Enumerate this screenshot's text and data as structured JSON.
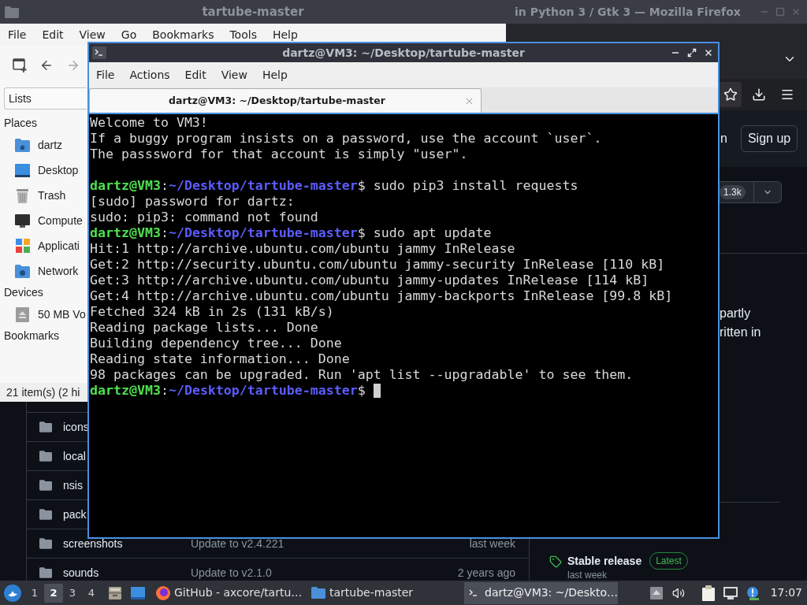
{
  "file_manager": {
    "title": "tartube-master",
    "menu": [
      "File",
      "Edit",
      "View",
      "Go",
      "Bookmarks",
      "Tools",
      "Help"
    ],
    "side_pane": "Lists",
    "sections": [
      {
        "heading": "Places",
        "items": [
          {
            "label": "dartz",
            "kind": "home"
          },
          {
            "label": "Desktop",
            "kind": "desktop"
          },
          {
            "label": "Trash",
            "kind": "trash"
          },
          {
            "label": "Compute",
            "kind": "computer"
          },
          {
            "label": "Applicati",
            "kind": "applications"
          },
          {
            "label": "Network",
            "kind": "network"
          }
        ]
      },
      {
        "heading": "Devices",
        "items": [
          {
            "label": "50 MB Vo",
            "kind": "drive"
          }
        ]
      },
      {
        "heading": "Bookmarks"
      }
    ],
    "status": "21 item(s) (2 hi"
  },
  "browser": {
    "title": "in Python 3 / Gtk 3 — Mozilla Firefox",
    "header_link": "n",
    "signup_button": "Sign up",
    "button_counter": "1.3k",
    "about_text": [
      "partly",
      "ritten in"
    ],
    "files": [
      {
        "name": "icons"
      },
      {
        "name": "local"
      },
      {
        "name": "nsis"
      },
      {
        "name": "pack"
      },
      {
        "name": "screenshots",
        "message": "Update to v2.4.221",
        "date": "last week"
      },
      {
        "name": "sounds",
        "message": "Update to v2.1.0",
        "date": "2 years ago"
      }
    ],
    "release": {
      "title": "Stable release",
      "label": "Latest",
      "date": "last week"
    }
  },
  "terminal": {
    "title": "dartz@VM3: ~/Desktop/tartube-master",
    "menu": [
      "File",
      "Actions",
      "Edit",
      "View",
      "Help"
    ],
    "tabs": [
      {
        "label": "dartz@VM3: ~/Desktop/tartube-master",
        "selected": true
      }
    ],
    "lines": [
      {
        "kind": "output",
        "text": "Welcome to VM3!"
      },
      {
        "kind": "output",
        "text": "If a buggy program insists on a password, use the account `user`."
      },
      {
        "kind": "output",
        "text": "The passsword for that account is simply \"user\"."
      },
      {
        "kind": "blank"
      },
      {
        "kind": "prompt",
        "user": "dartz@VM3",
        "separator": ":",
        "path": "~/Desktop/tartube-master",
        "command": "$ sudo pip3 install requests"
      },
      {
        "kind": "output",
        "text": "[sudo] password for dartz:"
      },
      {
        "kind": "output",
        "text": "sudo: pip3: command not found"
      },
      {
        "kind": "prompt",
        "user": "dartz@VM3",
        "separator": ":",
        "path": "~/Desktop/tartube-master",
        "command": "$ sudo apt update"
      },
      {
        "kind": "output",
        "text": "Hit:1 http://archive.ubuntu.com/ubuntu jammy InRelease"
      },
      {
        "kind": "output",
        "text": "Get:2 http://security.ubuntu.com/ubuntu jammy-security InRelease [110 kB]"
      },
      {
        "kind": "output",
        "text": "Get:3 http://archive.ubuntu.com/ubuntu jammy-updates InRelease [114 kB]"
      },
      {
        "kind": "output",
        "text": "Get:4 http://archive.ubuntu.com/ubuntu jammy-backports InRelease [99.8 kB]"
      },
      {
        "kind": "output",
        "text": "Fetched 324 kB in 2s (131 kB/s)"
      },
      {
        "kind": "output",
        "text": "Reading package lists... Done"
      },
      {
        "kind": "output",
        "text": "Building dependency tree... Done"
      },
      {
        "kind": "output",
        "text": "Reading state information... Done"
      },
      {
        "kind": "output",
        "text": "98 packages can be upgraded. Run 'apt list --upgradable' to see them."
      },
      {
        "kind": "prompt",
        "user": "dartz@VM3",
        "separator": ":",
        "path": "~/Desktop/tartube-master",
        "command": "$"
      }
    ],
    "cursor": true
  },
  "taskbar": {
    "workspaces": [
      {
        "label": "1",
        "selected": false
      },
      {
        "label": "2",
        "selected": true
      },
      {
        "label": "3",
        "selected": false
      },
      {
        "label": "4",
        "selected": false
      }
    ],
    "tasks": [
      {
        "label": "GitHub - axcore/tartu…",
        "kind": "browser",
        "selected": false
      },
      {
        "label": "tartube-master",
        "kind": "folder",
        "selected": false
      },
      {
        "label": "dartz@VM3: ~/Deskto…",
        "kind": "terminal",
        "selected": true
      }
    ],
    "clock": "17:07"
  }
}
